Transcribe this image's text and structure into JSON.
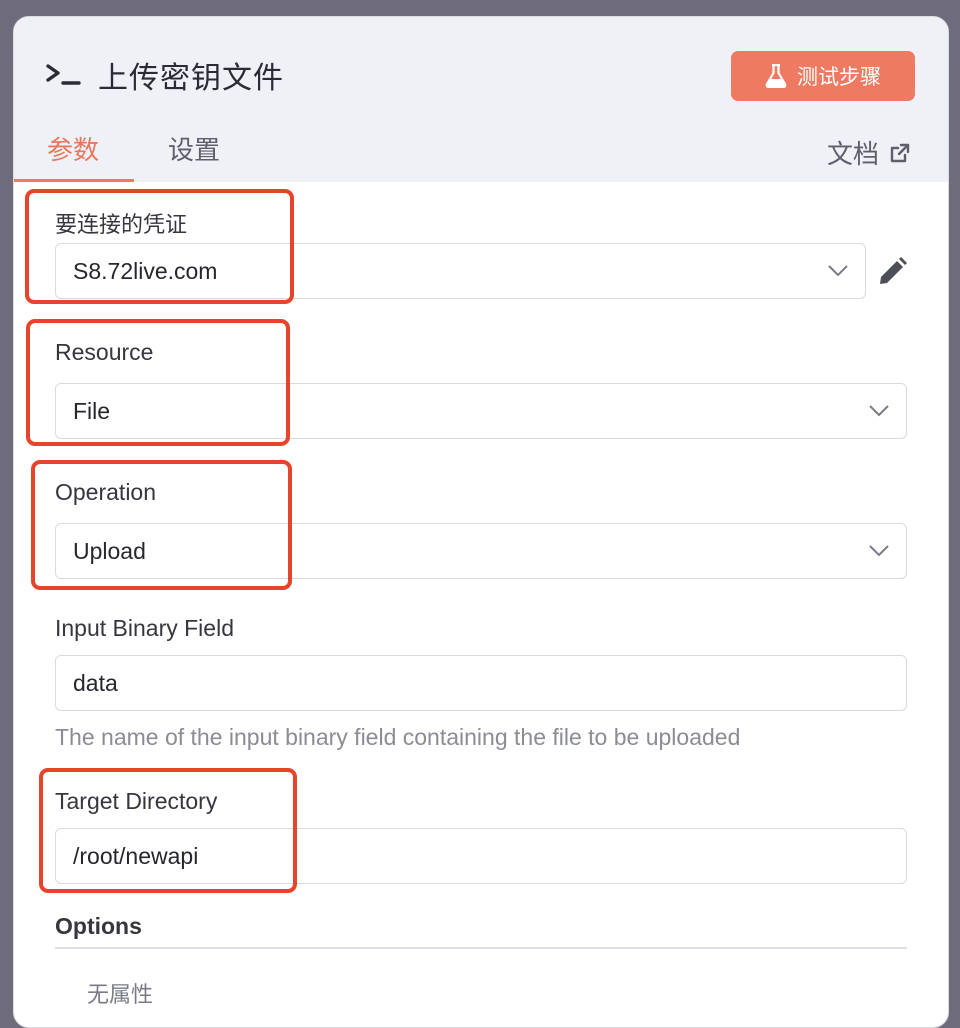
{
  "node": {
    "title": "上传密钥文件",
    "test_button_label": "测试步骤"
  },
  "tabs": [
    {
      "label": "参数",
      "active": true
    },
    {
      "label": "设置",
      "active": false
    }
  ],
  "docs_link_label": "文档",
  "fields": {
    "credential": {
      "label": "要连接的凭证",
      "value": "S8.72live.com"
    },
    "resource": {
      "label": "Resource",
      "value": "File"
    },
    "operation": {
      "label": "Operation",
      "value": "Upload"
    },
    "binary_field": {
      "label": "Input Binary Field",
      "value": "data",
      "hint": "The name of the input binary field containing the file to be uploaded"
    },
    "target_directory": {
      "label": "Target Directory",
      "value": "/root/newapi"
    }
  },
  "options": {
    "title": "Options",
    "empty_text": "无属性"
  },
  "colors": {
    "accent": "#ee7b61",
    "highlight": "#e6452b",
    "header_bg": "#f0f1f6"
  }
}
